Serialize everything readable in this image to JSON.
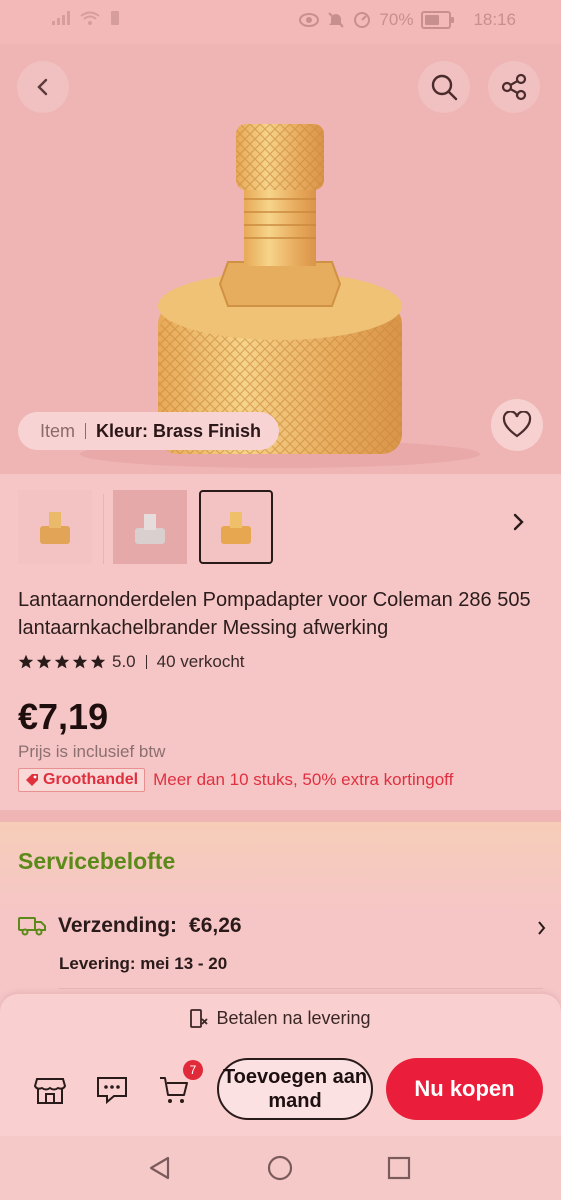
{
  "status_bar": {
    "battery_text": "70%",
    "battery_level": 0.7,
    "time": "18:16"
  },
  "hero": {
    "item_label": "Item",
    "color_label": "Kleur: Brass Finish"
  },
  "product": {
    "title": "Lantaarnonderdelen Pompadapter voor Coleman 286 505 lantaarnkachelbrander Messing afwerking",
    "rating": "5.0",
    "stars": 5,
    "sold": "40 verkocht",
    "price": "€7,19",
    "tax_note": "Prijs is inclusief btw",
    "wholesale_badge": "Groothandel",
    "wholesale_text": "Meer dan 10 stuks, 50% extra kortingoff"
  },
  "service": {
    "title": "Servicebelofte",
    "shipping_label": "Verzending:",
    "shipping_price": "€6,26",
    "delivery": "Levering: mei 13 - 20"
  },
  "bottom_bar": {
    "payment": "Betalen na levering",
    "cart_count": "7",
    "add_to_cart": "Toevoegen aan mand",
    "buy_now": "Nu kopen"
  },
  "colors": {
    "accent": "#ea1e3a",
    "service_green": "#5c8a1a",
    "background": "#f6c6c6"
  }
}
